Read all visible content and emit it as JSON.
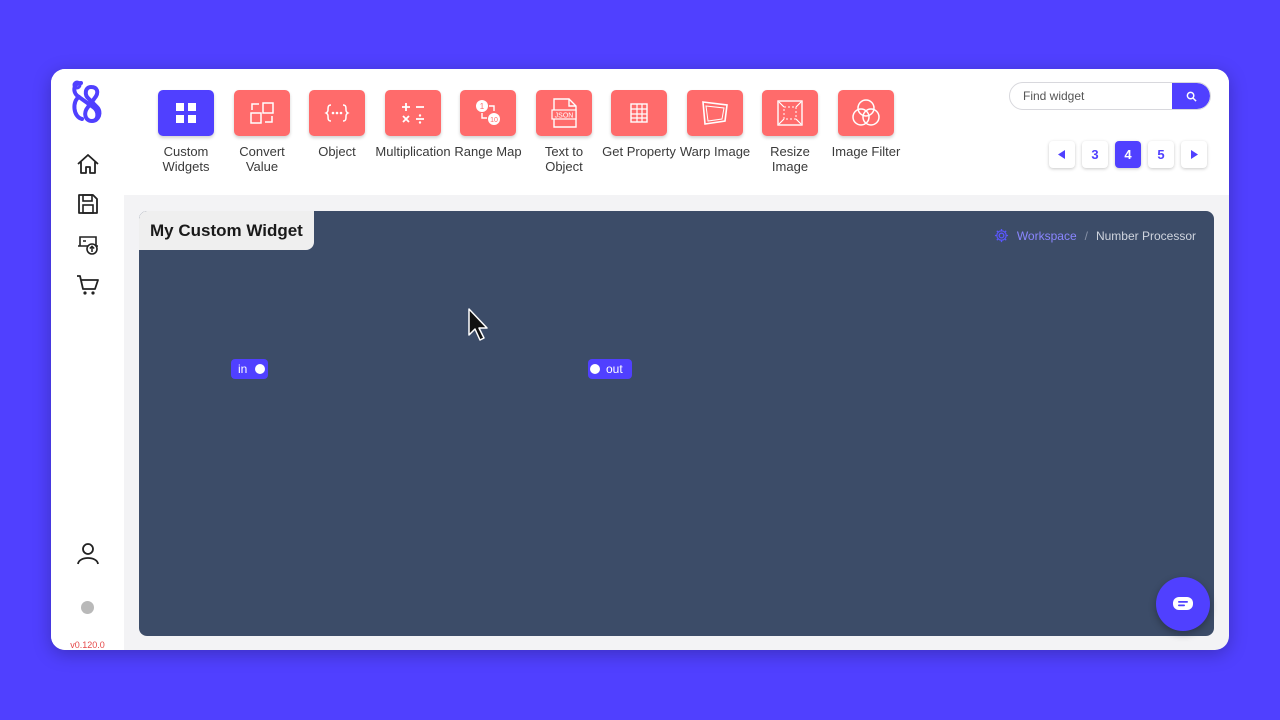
{
  "app": {
    "version": "v0.120.0"
  },
  "sidebar": {
    "items": [
      {
        "name": "home",
        "icon": "home-icon"
      },
      {
        "name": "save",
        "icon": "save-icon"
      },
      {
        "name": "upload",
        "icon": "cloud-upload-icon"
      },
      {
        "name": "store",
        "icon": "cart-icon"
      }
    ],
    "bottom": [
      {
        "name": "account",
        "icon": "user-icon"
      },
      {
        "name": "status",
        "icon": "status-dot"
      }
    ]
  },
  "toolbar": {
    "widgets": [
      {
        "label": "Custom Widgets",
        "icon": "grid-icon",
        "active": true
      },
      {
        "label": "Convert Value",
        "icon": "convert-icon",
        "active": false
      },
      {
        "label": "Object",
        "icon": "braces-icon",
        "active": false
      },
      {
        "label": "Multiplication",
        "icon": "math-ops-icon",
        "active": false
      },
      {
        "label": "Range Map",
        "icon": "range-map-icon",
        "active": false
      },
      {
        "label": "Text to Object",
        "icon": "json-file-icon",
        "active": false
      },
      {
        "label": "Get Property",
        "icon": "table-icon",
        "active": false
      },
      {
        "label": "Warp Image",
        "icon": "warp-icon",
        "active": false
      },
      {
        "label": "Resize Image",
        "icon": "resize-icon",
        "active": false
      },
      {
        "label": "Image Filter",
        "icon": "filter-circles-icon",
        "active": false
      }
    ],
    "search": {
      "placeholder": "Find widget",
      "value": "",
      "icon": "search-icon"
    },
    "pagination": {
      "prev_icon": "caret-left-icon",
      "next_icon": "caret-right-icon",
      "pages": [
        "3",
        "4",
        "5"
      ],
      "current": "4"
    }
  },
  "workspace": {
    "title": "My Custom Widget",
    "breadcrumb": {
      "icon": "gear-icon",
      "root": "Workspace",
      "separator": "/",
      "current": "Number Processor"
    },
    "nodes": {
      "input_label": "in",
      "output_label": "out"
    }
  },
  "chat": {
    "icon": "chat-icon"
  },
  "colors": {
    "accent": "#5040ff",
    "widget_tile": "#ff6b6b",
    "canvas": "#3c4c68"
  }
}
